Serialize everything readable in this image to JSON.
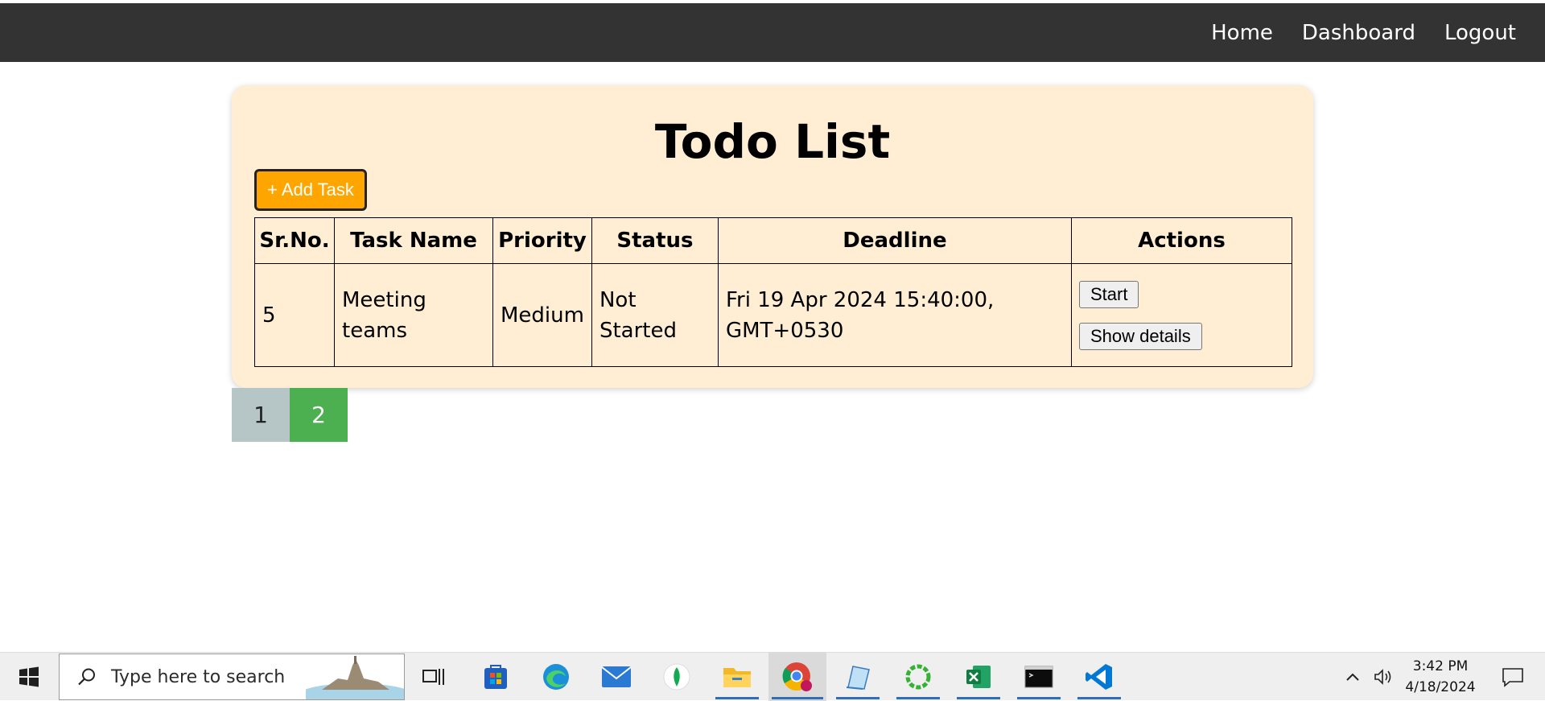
{
  "nav": {
    "items": [
      {
        "label": "Home"
      },
      {
        "label": "Dashboard"
      },
      {
        "label": "Logout"
      }
    ]
  },
  "todo": {
    "title": "Todo List",
    "add_label": "+ Add Task",
    "headers": [
      "Sr.No.",
      "Task Name",
      "Priority",
      "Status",
      "Deadline",
      "Actions"
    ],
    "rows": [
      {
        "srno": "5",
        "name": "Meeting teams",
        "priority": "Medium",
        "status": "Not Started",
        "deadline": "Fri 19 Apr 2024 15:40:00, GMT+0530",
        "actions": [
          "Start",
          "Show details"
        ]
      }
    ]
  },
  "pagination": {
    "pages": [
      "1",
      "2"
    ],
    "current": "2"
  },
  "taskbar": {
    "search_placeholder": "Type here to search",
    "apps": [
      "start-icon",
      "task-view-icon",
      "store-icon",
      "edge-icon",
      "mail-icon",
      "mongodb-icon",
      "file-explorer-icon",
      "chrome-icon",
      "notepad-icon",
      "app-ring-icon",
      "excel-icon",
      "terminal-icon",
      "vscode-icon"
    ],
    "time": "3:42 PM",
    "date": "4/18/2024"
  },
  "colors": {
    "topbar": "#333333",
    "card": "#ffeed3",
    "add_button": "#ffa500",
    "page_inactive": "#b6c5c5",
    "page_active": "#4caf50"
  }
}
